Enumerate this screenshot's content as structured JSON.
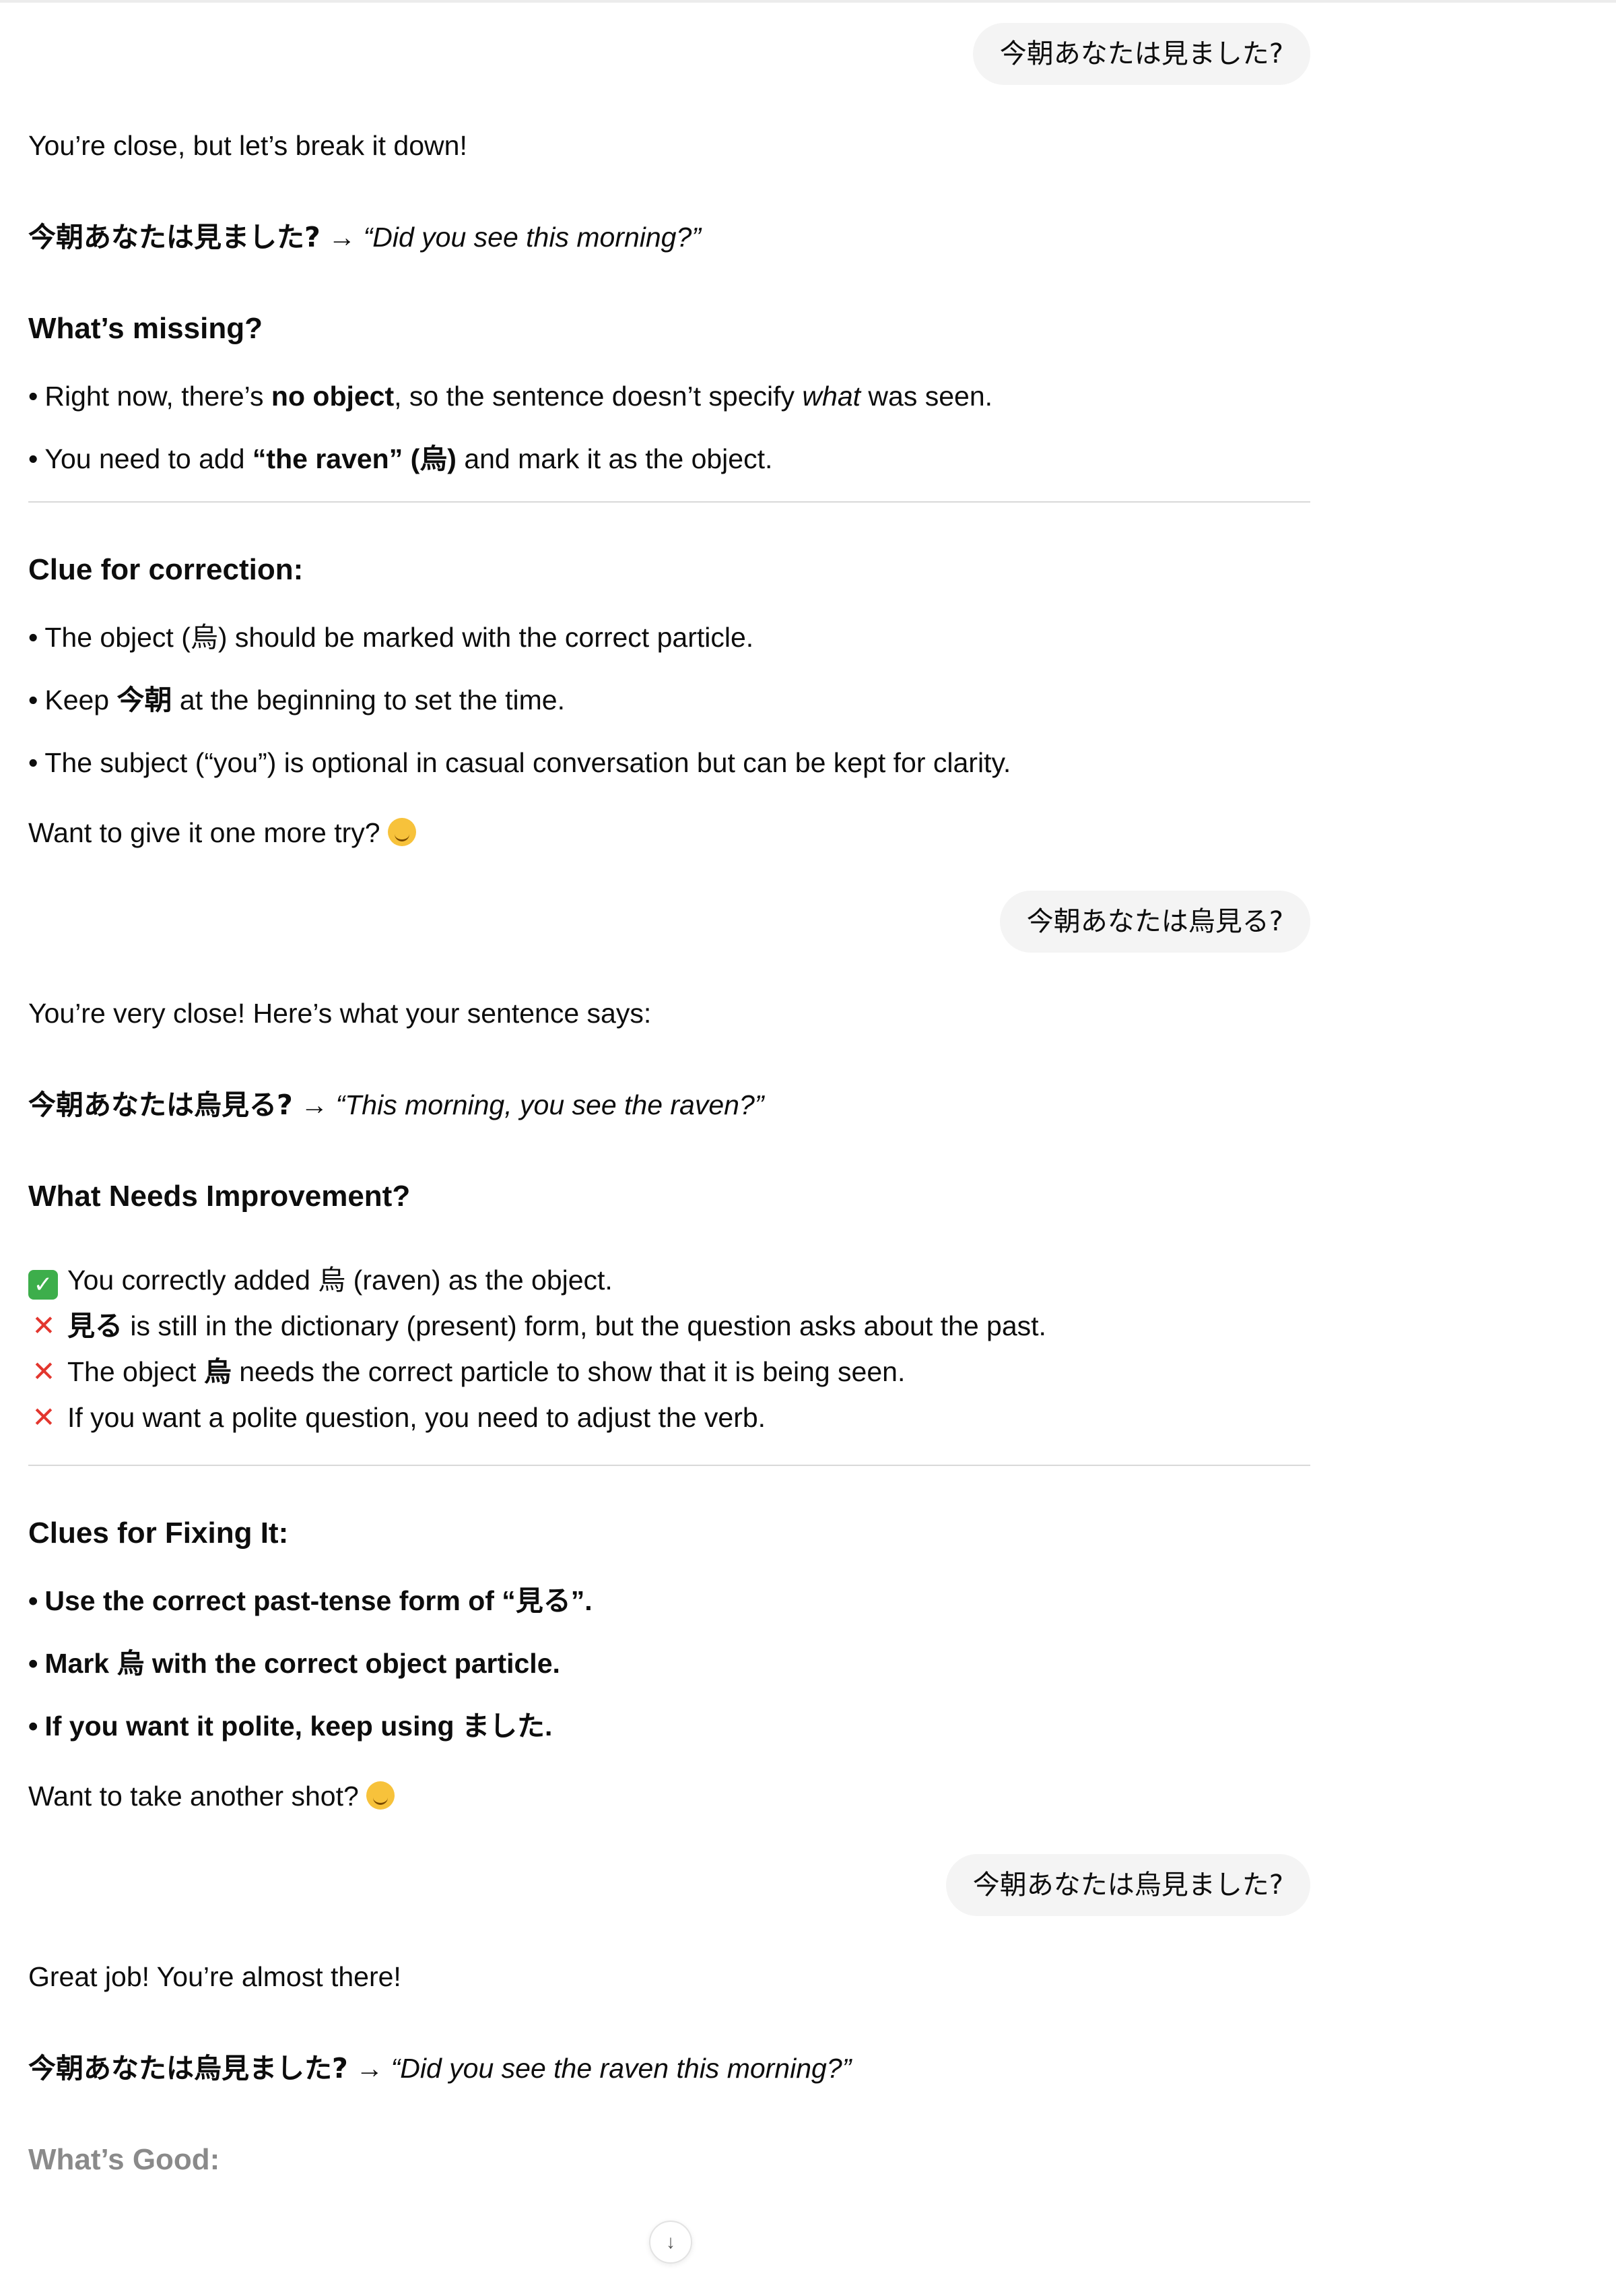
{
  "messages": [
    {
      "user": "今朝あなたは見ました?"
    },
    {
      "intro": "You’re close, but let’s break it down!",
      "sentence_jp": "今朝あなたは見ました?",
      "sentence_en": "“Did you see this morning?”",
      "h_missing": "What’s missing?",
      "missing_1a": "Right now, there’s ",
      "missing_1b": "no object",
      "missing_1c": ", so the sentence doesn’t specify ",
      "missing_1d": "what",
      "missing_1e": " was seen.",
      "missing_2a": "You need to add ",
      "missing_2b": "“the raven” (烏)",
      "missing_2c": " and mark it as the object.",
      "h_clue": "Clue for correction:",
      "clue_1": "The object (烏) should be marked with the correct particle.",
      "clue_2a": "Keep ",
      "clue_2b": "今朝",
      "clue_2c": " at the beginning to set the time.",
      "clue_3": "The subject (“you”) is optional in casual conversation but can be kept for clarity.",
      "outro": "Want to give it one more try?"
    },
    {
      "user": "今朝あなたは烏見る?"
    },
    {
      "intro": "You’re very close! Here’s what your sentence says:",
      "sentence_jp": "今朝あなたは烏見る?",
      "sentence_en": "“This morning, you see the raven?”",
      "h_improve": "What Needs Improvement?",
      "check_1": "You correctly added 烏 (raven) as the object.",
      "check_2a": "見る",
      "check_2b": " is still in the dictionary (present) form, but the question asks about the past.",
      "check_3a": "The object ",
      "check_3b": "烏",
      "check_3c": " needs the correct particle to show that it is being seen.",
      "check_4": "If you want a polite question, you need to adjust the verb.",
      "h_clues": "Clues for Fixing It:",
      "fix_1": "Use the correct past-tense form of “見る”.",
      "fix_2": "Mark 烏 with the correct object particle.",
      "fix_3": "If you want it polite, keep using ました.",
      "outro": "Want to take another shot?"
    },
    {
      "user": "今朝あなたは烏見ました?"
    },
    {
      "intro": "Great job! You’re almost there!",
      "sentence_jp": "今朝あなたは烏見ました?",
      "sentence_en": "“Did you see the raven this morning?”",
      "h_good": "What’s Good:"
    }
  ],
  "arrow": "→",
  "icons": {
    "check": "✓",
    "cross": "✕",
    "scroll": "↓",
    "smile_color": "#f7c23b"
  },
  "colors": {
    "bubble_bg": "#f4f4f4",
    "cross": "#e3362e",
    "check_bg": "#3dae4b"
  }
}
